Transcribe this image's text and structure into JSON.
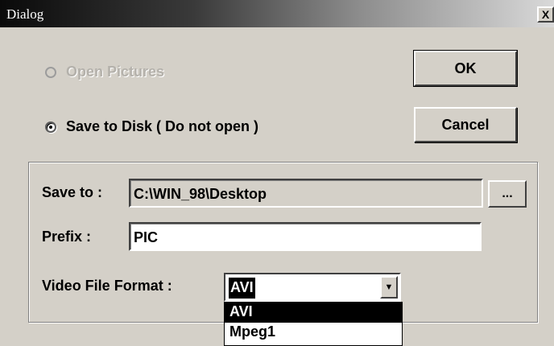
{
  "window": {
    "title": "Dialog",
    "close_label": "X"
  },
  "options": {
    "open_pictures": {
      "label": "Open Pictures",
      "enabled": false,
      "checked": false
    },
    "save_to_disk": {
      "label": "Save to Disk ( Do not open )",
      "enabled": true,
      "checked": true
    }
  },
  "buttons": {
    "ok": "OK",
    "cancel": "Cancel",
    "browse": "..."
  },
  "settings": {
    "save_to": {
      "label": "Save to :",
      "value": "C:\\WIN_98\\Desktop"
    },
    "prefix": {
      "label": "Prefix :",
      "value": "PIC"
    },
    "video_format": {
      "label": "Video File Format :",
      "selected": "AVI",
      "options": [
        "AVI",
        "Mpeg1"
      ]
    }
  },
  "icons": {
    "close": "close-icon",
    "dropdown": "triangle-down-icon"
  }
}
